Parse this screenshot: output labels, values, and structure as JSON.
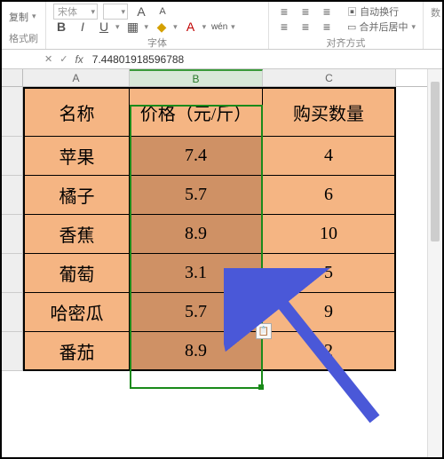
{
  "ribbon": {
    "clipboard": {
      "copy_label": "复制",
      "format_label": "格式刷"
    },
    "font": {
      "name": "宋体",
      "group_label": "字体"
    },
    "align": {
      "wrap_text": "自动换行",
      "merge_center": "合并后居中",
      "group_label": "对齐方式",
      "number_label": "数"
    }
  },
  "formula_bar": {
    "name_box": "",
    "value": "7.44801918596788"
  },
  "columns": {
    "a": "A",
    "b": "B",
    "c": "C"
  },
  "table": {
    "headers": {
      "name": "名称",
      "price": "价格（元/斤）",
      "qty": "购买数量"
    },
    "rows": [
      {
        "name": "苹果",
        "price": "7.4",
        "qty": "4"
      },
      {
        "name": "橘子",
        "price": "5.7",
        "qty": "6"
      },
      {
        "name": "香蕉",
        "price": "8.9",
        "qty": "10"
      },
      {
        "name": "葡萄",
        "price": "3.1",
        "qty": "5"
      },
      {
        "name": "哈密瓜",
        "price": "5.7",
        "qty": "9"
      },
      {
        "name": "番茄",
        "price": "8.9",
        "qty": "2"
      }
    ]
  },
  "chart_data": {
    "type": "table",
    "title": "",
    "columns": [
      "名称",
      "价格（元/斤）",
      "购买数量"
    ],
    "rows": [
      [
        "苹果",
        7.4,
        4
      ],
      [
        "橘子",
        5.7,
        6
      ],
      [
        "香蕉",
        8.9,
        10
      ],
      [
        "葡萄",
        3.1,
        5
      ],
      [
        "哈密瓜",
        5.7,
        9
      ],
      [
        "番茄",
        8.9,
        2
      ]
    ]
  }
}
